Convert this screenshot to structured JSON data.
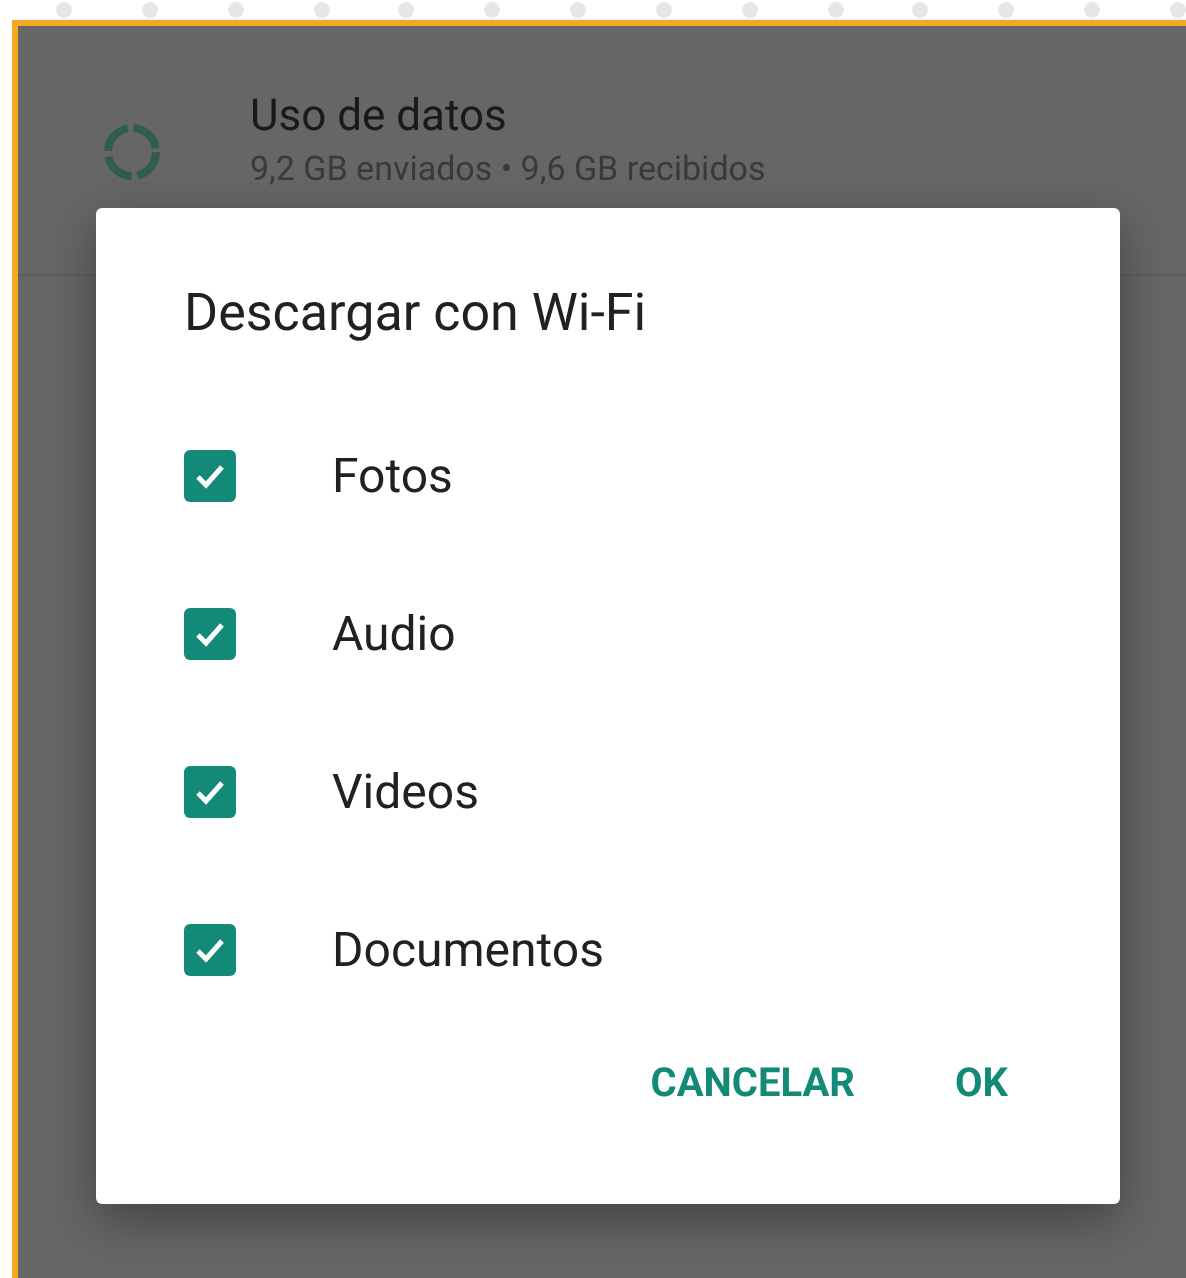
{
  "background_item": {
    "title": "Uso de datos",
    "subtitle": "9,2 GB enviados • 9,6 GB recibidos"
  },
  "dialog": {
    "title": "Descargar con Wi-Fi",
    "options": [
      {
        "label": "Fotos",
        "checked": true
      },
      {
        "label": "Audio",
        "checked": true
      },
      {
        "label": "Videos",
        "checked": true
      },
      {
        "label": "Documentos",
        "checked": true
      }
    ],
    "buttons": [
      "CANCELAR",
      "OK"
    ]
  }
}
